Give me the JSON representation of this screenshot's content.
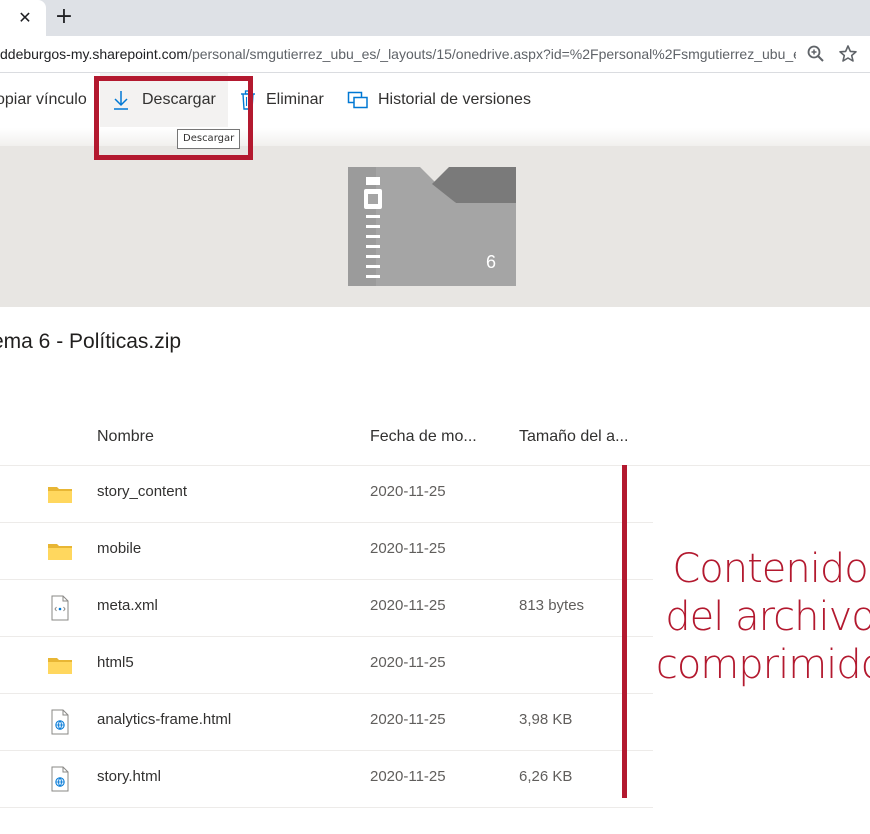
{
  "browser": {
    "tab_close_glyph": "✕",
    "new_tab_glyph": "+",
    "url_host": "ddeburgos-my.sharepoint.com",
    "url_path": "/personal/smgutierrez_ubu_es/_layouts/15/onedrive.aspx?id=%2Fpersonal%2Fsmgutierrez_ubu_e...",
    "icons": [
      "zoom-icon",
      "star-icon"
    ]
  },
  "commands": {
    "copy_link": "opiar vínculo",
    "download": "Descargar",
    "delete": "Eliminar",
    "version_history": "Historial de versiones",
    "tooltip": "Descargar",
    "icons": [
      "download-icon",
      "trash-icon",
      "version-history-icon"
    ],
    "accent": "#0078d4"
  },
  "preview": {
    "zip_count": "6"
  },
  "file": {
    "title": "ema 6 - Políticas.zip"
  },
  "table": {
    "columns": [
      "Nombre",
      "Fecha de mo...",
      "Tamaño del a..."
    ],
    "rows": [
      {
        "type": "folder",
        "name": "story_content",
        "date": "2020-11-25",
        "size": ""
      },
      {
        "type": "folder",
        "name": "mobile",
        "date": "2020-11-25",
        "size": ""
      },
      {
        "type": "xml",
        "name": "meta.xml",
        "date": "2020-11-25",
        "size": "813 bytes"
      },
      {
        "type": "folder",
        "name": "html5",
        "date": "2020-11-25",
        "size": ""
      },
      {
        "type": "html",
        "name": "analytics-frame.html",
        "date": "2020-11-25",
        "size": "3,98 KB"
      },
      {
        "type": "html",
        "name": "story.html",
        "date": "2020-11-25",
        "size": "6,26 KB"
      }
    ]
  },
  "annotation": {
    "text": "Contenido\ndel archivo\ncomprimido",
    "color": "#b3192f"
  }
}
